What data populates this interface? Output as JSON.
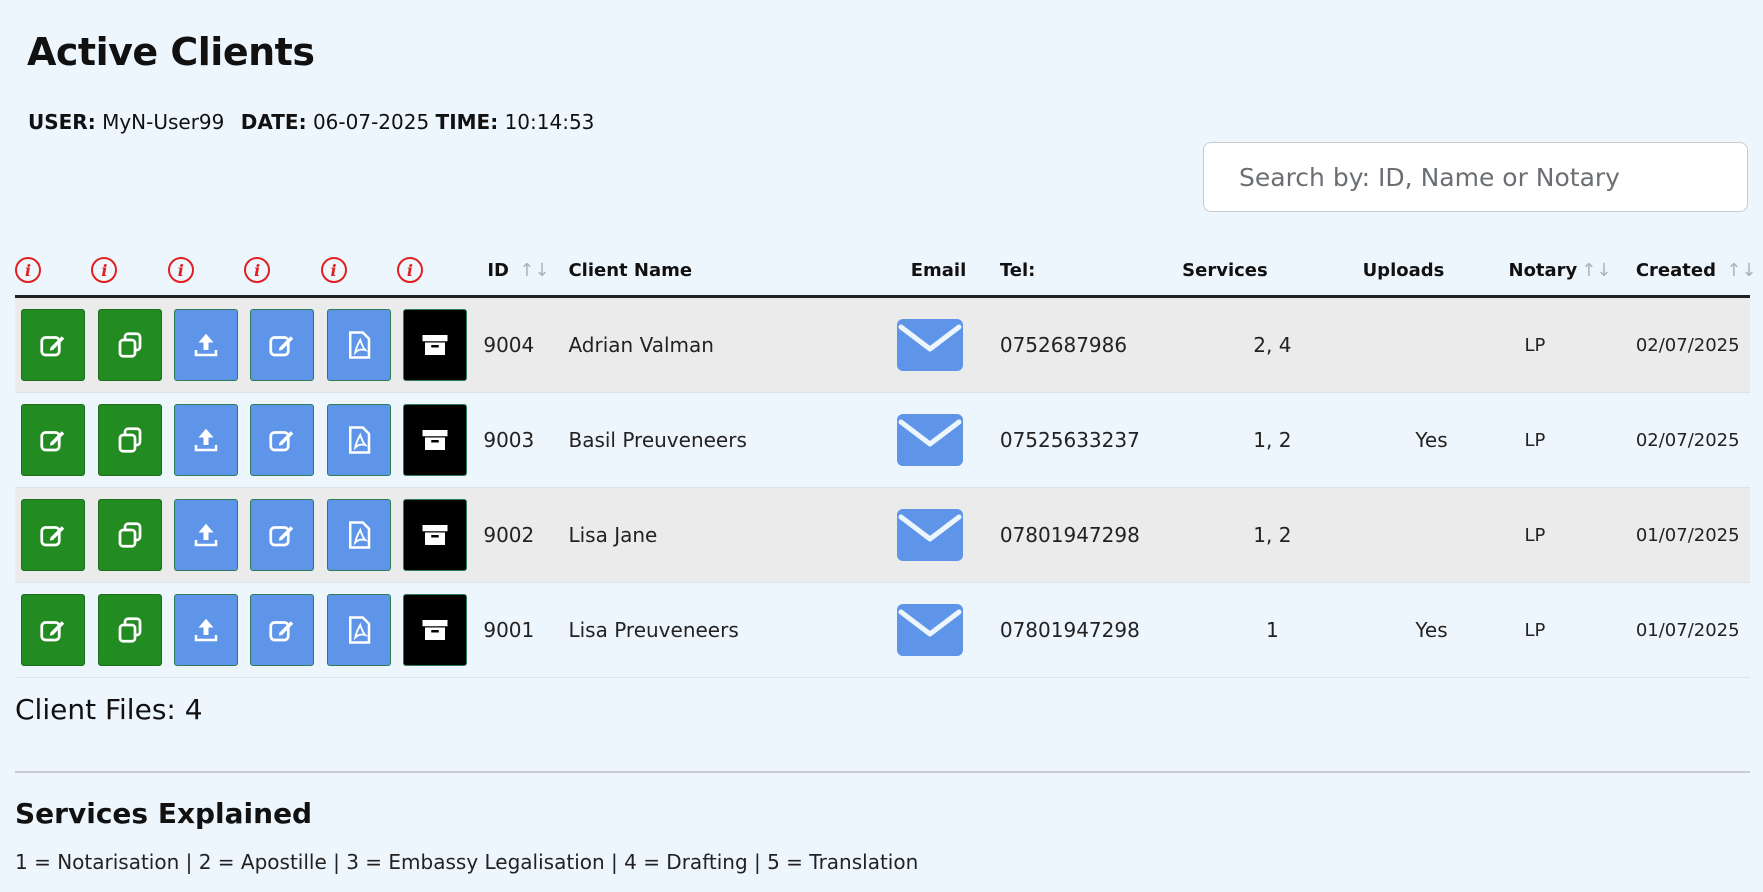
{
  "page": {
    "title": "Active Clients",
    "user_label": "USER:",
    "user_value": "MyN-User99",
    "date_label": "DATE:",
    "date_value": "06-07-2025",
    "time_label": "TIME:",
    "time_value": "10:14:53"
  },
  "search": {
    "placeholder": "Search by: ID, Name or Notary",
    "value": ""
  },
  "table": {
    "info_icon_glyph": "i",
    "sort_icon_glyph": "↑↓",
    "headers": {
      "id": "ID",
      "client_name": "Client Name",
      "email": "Email",
      "tel": "Tel:",
      "services": "Services",
      "uploads": "Uploads",
      "notary": "Notary",
      "created": "Created"
    },
    "action_icons": [
      "edit-icon",
      "copy-icon",
      "upload-icon",
      "edit-icon",
      "pdf-icon",
      "archive-icon"
    ],
    "rows": [
      {
        "id": "9004",
        "name": "Adrian Valman",
        "tel": "0752687986",
        "services": "2, 4",
        "uploads": "",
        "notary": "LP",
        "created": "02/07/2025"
      },
      {
        "id": "9003",
        "name": "Basil Preuveneers",
        "tel": "07525633237",
        "services": "1, 2",
        "uploads": "Yes",
        "notary": "LP",
        "created": "02/07/2025"
      },
      {
        "id": "9002",
        "name": "Lisa Jane",
        "tel": "07801947298",
        "services": "1, 2",
        "uploads": "",
        "notary": "LP",
        "created": "01/07/2025"
      },
      {
        "id": "9001",
        "name": "Lisa Preuveneers",
        "tel": "07801947298",
        "services": "1",
        "uploads": "Yes",
        "notary": "LP",
        "created": "01/07/2025"
      }
    ]
  },
  "footer": {
    "client_files": "Client Files: 4",
    "services_title": "Services Explained",
    "services_text": "1 = Notarisation | 2 = Apostille | 3 = Embassy Legalisation | 4 = Drafting | 5 = Translation"
  },
  "colors": {
    "background": "#eef6fd",
    "green_button": "#228b22",
    "blue_button": "#5f95e8",
    "black_button": "#000000",
    "info_red": "#e02020",
    "mail_blue": "#5f95e8",
    "row_shade": "#ebebeb"
  }
}
